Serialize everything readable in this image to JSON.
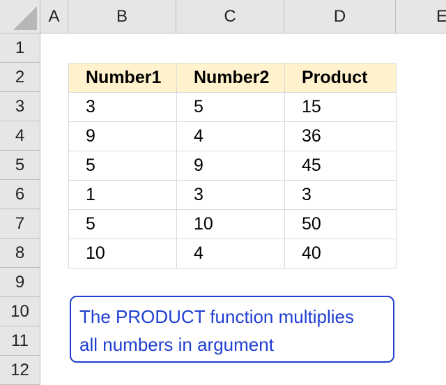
{
  "columns": [
    "A",
    "B",
    "C",
    "D",
    "E"
  ],
  "rows": [
    "1",
    "2",
    "3",
    "4",
    "5",
    "6",
    "7",
    "8",
    "9",
    "10",
    "11",
    "12"
  ],
  "table": {
    "headers": [
      "Number1",
      "Number2",
      "Product"
    ],
    "rows": [
      [
        "3",
        "5",
        "15"
      ],
      [
        "9",
        "4",
        "36"
      ],
      [
        "5",
        "9",
        "45"
      ],
      [
        "1",
        "3",
        "3"
      ],
      [
        "5",
        "10",
        "50"
      ],
      [
        "10",
        "4",
        "40"
      ]
    ]
  },
  "callout": {
    "line1": "The PRODUCT function multiplies",
    "line2": "all numbers in argument"
  },
  "colors": {
    "header_fill": "#fff2cc",
    "callout_blue": "#1f3fd1",
    "grid_header_bg": "#e6e6e6"
  }
}
